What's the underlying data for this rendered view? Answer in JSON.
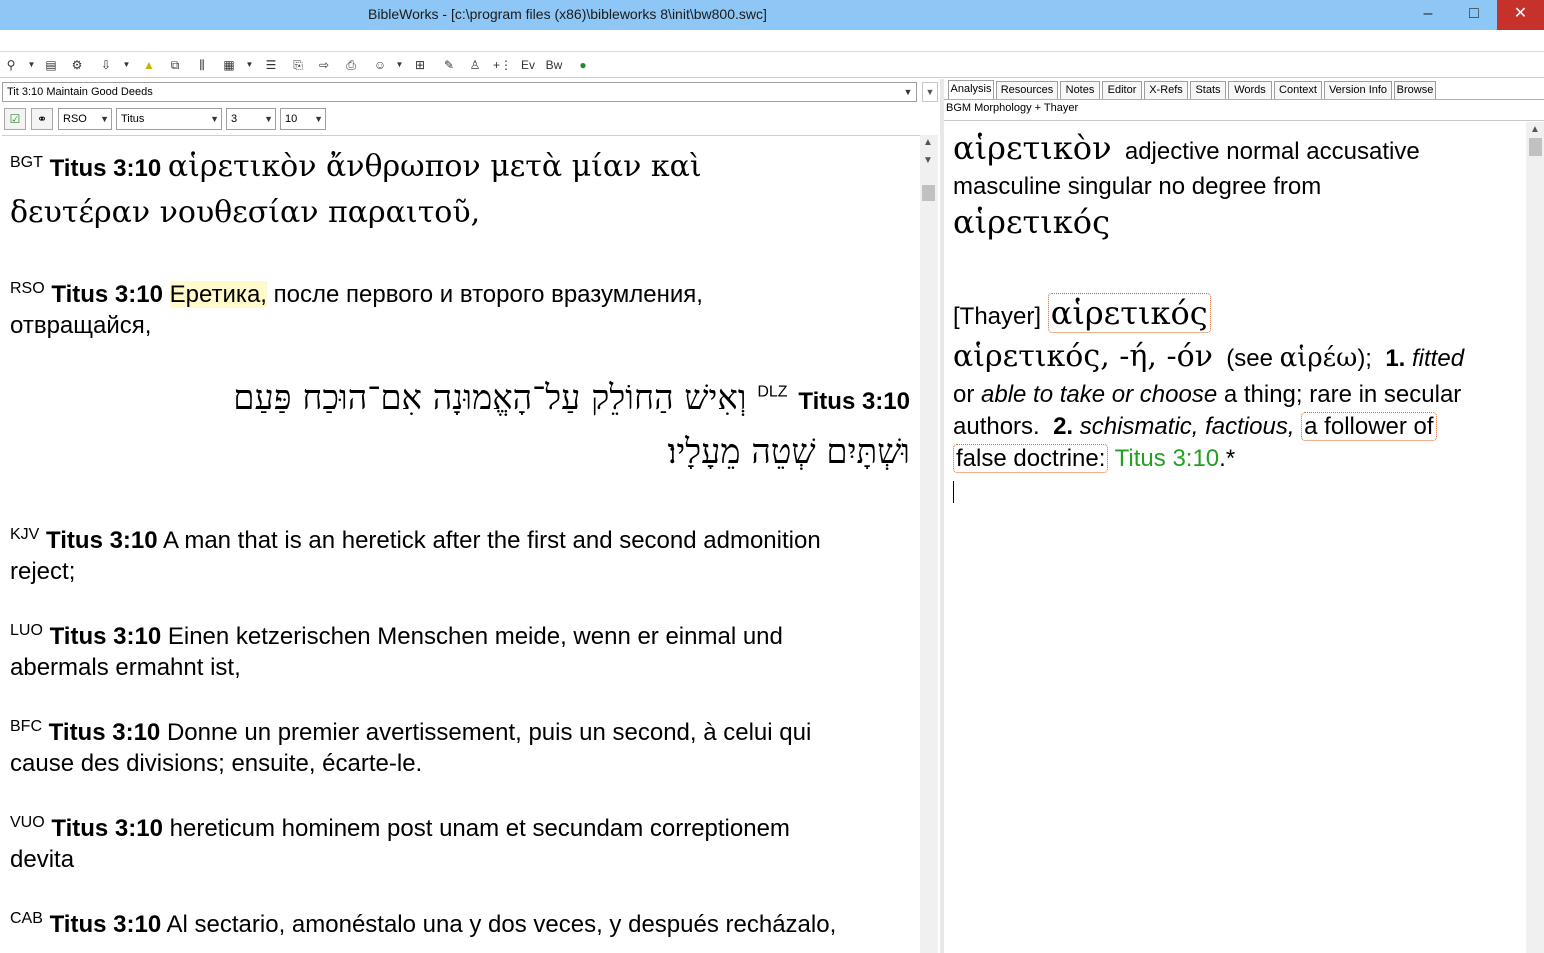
{
  "window": {
    "title": "BibleWorks - [c:\\program files (x86)\\bibleworks 8\\init\\bw800.swc]",
    "minimize": "–",
    "maximize": "□",
    "close": "✕"
  },
  "toolbar": {
    "icons": [
      "search-icon",
      "browse-icon",
      "options-icon",
      "install-icon",
      "highlight-icon",
      "windows-icon",
      "parallel-icon",
      "grid-icon",
      "list-icon",
      "copy-icon",
      "export-icon",
      "print-icon",
      "user-icon",
      "layout-icon",
      "note-icon",
      "notes-icon",
      "add-icon",
      "ev-icon",
      "bw-icon",
      "globe-icon"
    ],
    "labels": {
      "ev": "Ev",
      "bw": "Bw"
    }
  },
  "left": {
    "verse_select": "Tit 3:10 Maintain Good Deeds",
    "version": "RSO",
    "book": "Titus",
    "chapter": "3",
    "verse": "10",
    "verses": [
      {
        "abbr": "BGT",
        "ref": "Titus 3:10",
        "line1": "αἱρετικὸν ἄνθρωπον μετὰ μίαν καὶ",
        "line2": "δευτέραν νουθεσίαν παραιτοῦ,"
      },
      {
        "abbr": "RSO",
        "ref": "Titus 3:10",
        "highlight": "Еретика,",
        "rest": " после первого и второго вразумления,",
        "line2": "отвращайся,"
      },
      {
        "abbr": "DLZ",
        "ref": "Titus 3:10",
        "line1": "וְאִישׁ הַחוֹלֵק עַל־הָאֱמוּנָה אִם־הוּכַח פַּעַם",
        "line2": "וּשְׁתָּיִם שְׁטֵה מֵעָלָיו׃"
      },
      {
        "abbr": "KJV",
        "ref": "Titus 3:10",
        "line1": "A man that is an heretick after the first and second admonition",
        "line2": "reject;"
      },
      {
        "abbr": "LUO",
        "ref": "Titus 3:10",
        "line1": "Einen ketzerischen Menschen meide, wenn er einmal und",
        "line2": "abermals ermahnt ist,"
      },
      {
        "abbr": "BFC",
        "ref": "Titus 3:10",
        "line1": "Donne un premier avertissement, puis un second, à celui qui",
        "line2": "cause des divisions; ensuite, écarte-le."
      },
      {
        "abbr": "VUO",
        "ref": "Titus 3:10",
        "line1": "hereticum hominem post unam et secundam correptionem",
        "line2": "devita"
      },
      {
        "abbr": "CAB",
        "ref": "Titus 3:10",
        "line1": "Al sectario, amonéstalo una y dos veces, y después recházalo,",
        "line2": ""
      }
    ]
  },
  "right": {
    "tabs": [
      "Analysis",
      "Resources",
      "Notes",
      "Editor",
      "X-Refs",
      "Stats",
      "Words",
      "Context",
      "Version Info",
      "Browse"
    ],
    "active_tab": "Analysis",
    "subheader": "BGM Morphology + Thayer",
    "analysis": {
      "word": "αἱρετικὸν",
      "desc1": "adjective normal accusative",
      "desc2": "masculine singular no degree from",
      "lemma": "αἱρετικός",
      "thayer_label": "[Thayer]",
      "thayer_lemma": "αἱρετικός",
      "entry_head": "αἱρετικός",
      "entry_forms": ", -ή, -όν",
      "see_open": "(see ",
      "see_word": "αἱρέω",
      "see_close": ");",
      "n1": "1.",
      "def1_italic": "fitted",
      "def1b_pre": "or ",
      "def1b_italic": "able to take or choose",
      "def1b_post": " a thing; rare in secular",
      "def1c": "authors.",
      "n2": "2.",
      "def2_italic": "schismatic, factious,",
      "def2_box": "a follower of",
      "def2_box2": "false doctrine:",
      "ref": "Titus 3:10",
      "star": ".*"
    }
  },
  "colors": {
    "titlebar": "#8ec6f5",
    "close": "#c7312b",
    "highlight": "#fffac9",
    "green_link": "#22a022",
    "dotted_box": "#e06020"
  }
}
